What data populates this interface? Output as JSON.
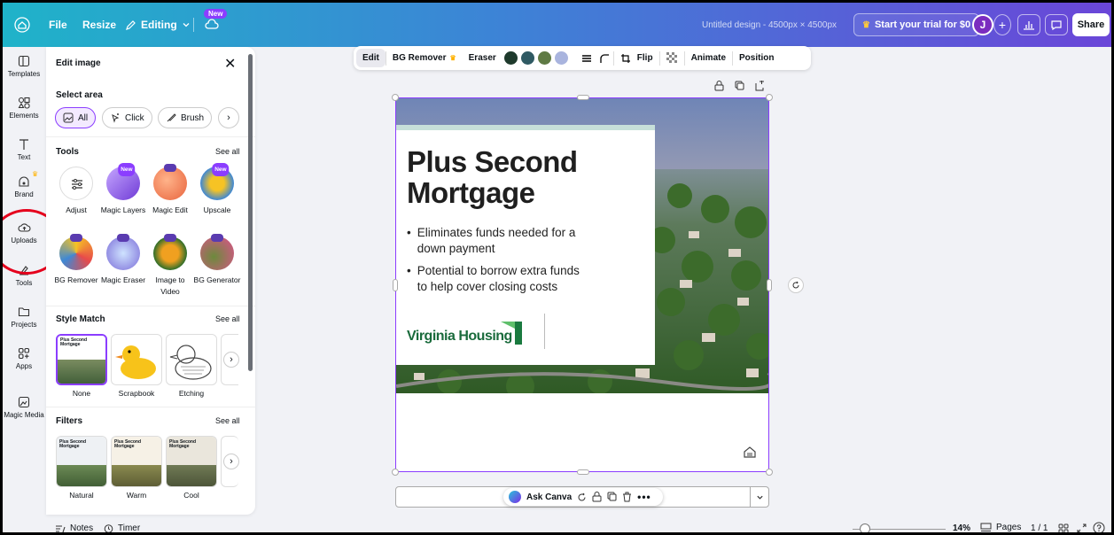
{
  "topbar": {
    "file_label": "File",
    "resize_label": "Resize",
    "editing_label": "Editing",
    "new_badge": "New",
    "doc_title": "Untitled design - 4500px × 4500px",
    "trial_label": "Start your trial for $0",
    "avatar_initial": "J",
    "share_label": "Share"
  },
  "rail": {
    "items": [
      "Templates",
      "Elements",
      "Text",
      "Brand",
      "Uploads",
      "Tools",
      "Projects",
      "Apps",
      "Magic Media"
    ]
  },
  "panel": {
    "title": "Edit image",
    "select_area": "Select area",
    "chips": [
      "All",
      "Click",
      "Brush"
    ],
    "tools_heading": "Tools",
    "see_all": "See all",
    "tools": [
      "Adjust",
      "Magic Layers",
      "Magic Edit",
      "Upscale",
      "BG Remover",
      "Magic Eraser",
      "Image to Video",
      "BG Generator"
    ],
    "tool_badge": "New",
    "style_match_heading": "Style Match",
    "styles": [
      "None",
      "Scrapbook",
      "Etching"
    ],
    "filters_heading": "Filters",
    "filters": [
      "Natural",
      "Warm",
      "Cool"
    ],
    "thumb_text": "Plus Second Mortgage"
  },
  "toolbar": {
    "edit": "Edit",
    "bg_remover": "BG Remover",
    "eraser": "Eraser",
    "flip": "Flip",
    "animate": "Animate",
    "position": "Position",
    "swatches": [
      "#1e3a2c",
      "#2f5a63",
      "#5f7a44",
      "#a9b4de"
    ]
  },
  "canvas": {
    "heading_line1": "Plus Second",
    "heading_line2": "Mortgage",
    "bullet1_line1": "Eliminates funds needed for a",
    "bullet1_line2": "down payment",
    "bullet2_line1": "Potential to borrow extra funds",
    "bullet2_line2": "to help cover closing costs",
    "logo_text": "Virginia Housing"
  },
  "ask_canva": {
    "label": "Ask Canva"
  },
  "footer": {
    "notes": "Notes",
    "timer": "Timer",
    "zoom": "14%",
    "pages_label": "Pages",
    "pages_count": "1 / 1"
  }
}
